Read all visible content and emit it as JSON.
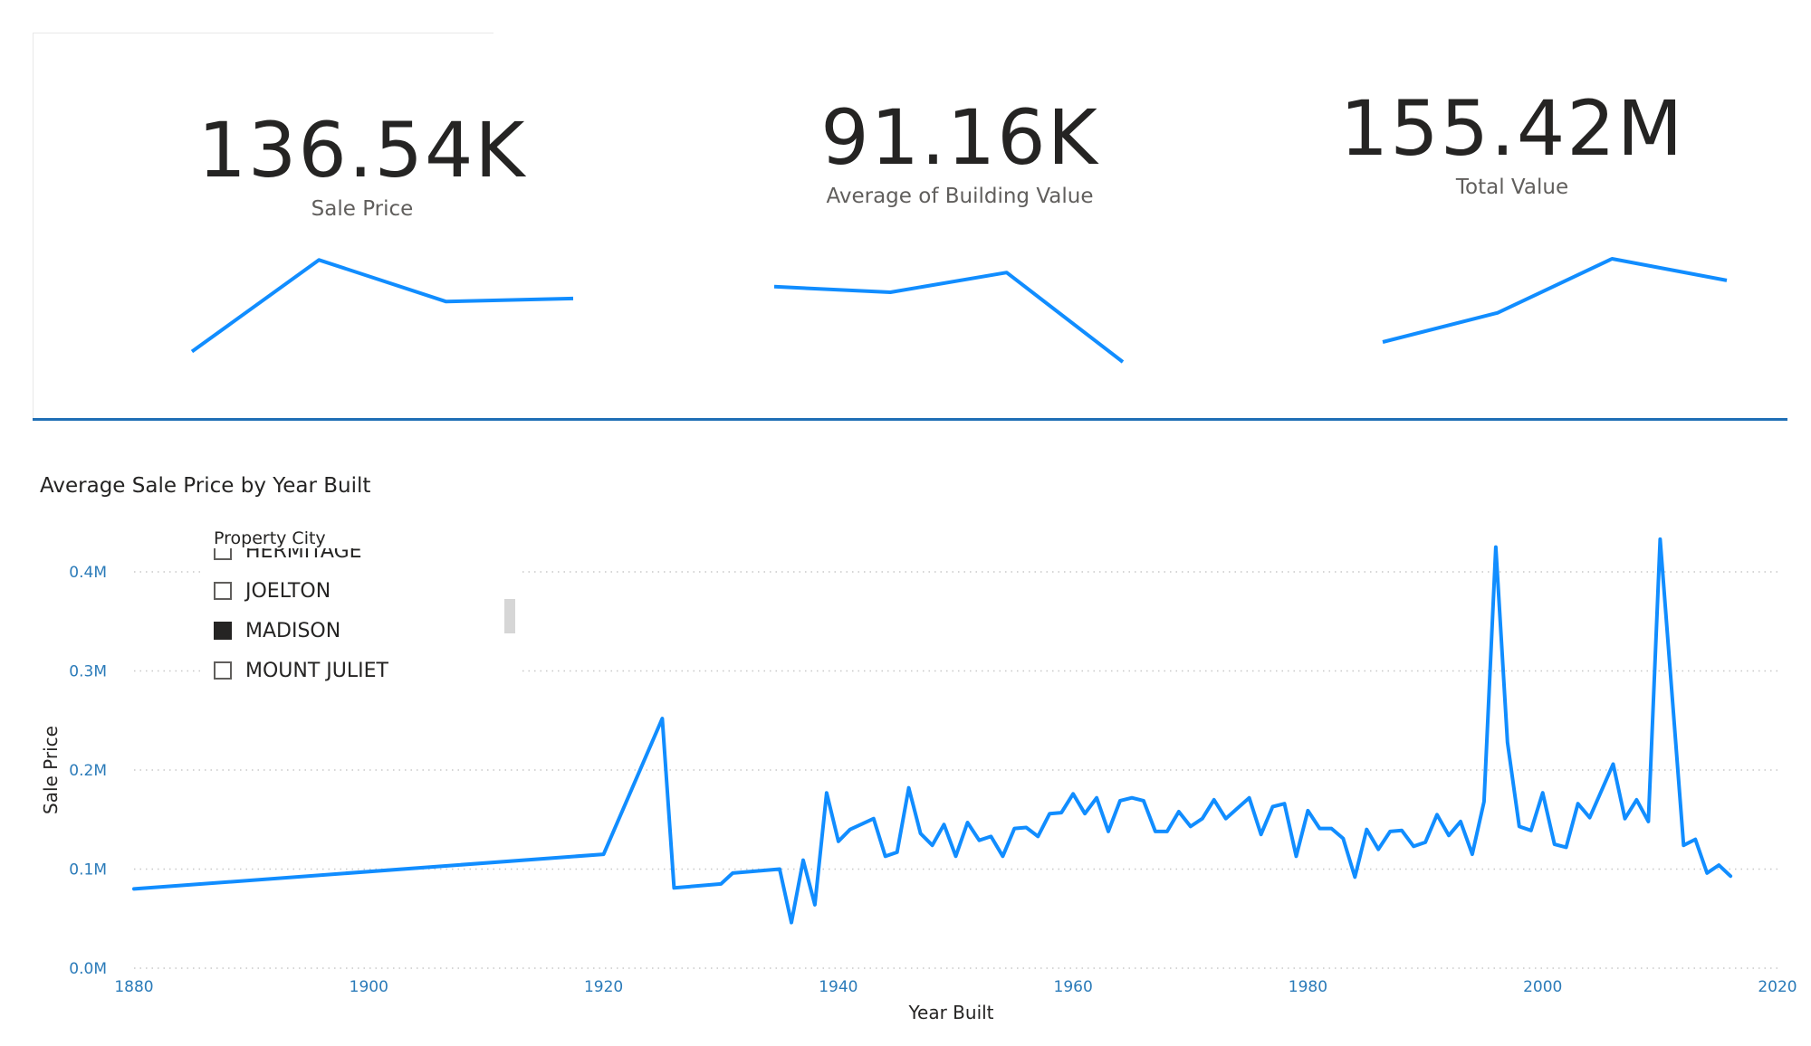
{
  "kpis": [
    {
      "value": "136.54K",
      "label": "Sale Price",
      "trend": [
        0.1,
        0.98,
        0.58,
        0.61
      ]
    },
    {
      "value": "91.16K",
      "label": "Average of Building Value",
      "trend": [
        0.8,
        0.74,
        0.95,
        0.0
      ]
    },
    {
      "value": "155.42M",
      "label": "Total Value",
      "trend": [
        0.0,
        0.35,
        1.0,
        0.74
      ]
    }
  ],
  "accent_color": "#118dff",
  "divider_color": "#1f6fb5",
  "slicer": {
    "header": "Property City",
    "items": [
      {
        "label": "HERMITAGE",
        "checked": false
      },
      {
        "label": "JOELTON",
        "checked": false
      },
      {
        "label": "MADISON",
        "checked": true
      },
      {
        "label": "MOUNT JULIET",
        "checked": false
      }
    ]
  },
  "chart_data": {
    "type": "line",
    "title": "Average Sale Price by Year Built",
    "xlabel": "Year Built",
    "ylabel": "Sale Price",
    "xlim": [
      1880,
      2020
    ],
    "ylim": [
      0,
      400000
    ],
    "x_ticks": [
      1880,
      1900,
      1920,
      1940,
      1960,
      1980,
      2000,
      2020
    ],
    "y_ticks": [
      {
        "value": 0,
        "label": "0.0M"
      },
      {
        "value": 100000,
        "label": "0.1M"
      },
      {
        "value": 200000,
        "label": "0.2M"
      },
      {
        "value": 300000,
        "label": "0.3M"
      },
      {
        "value": 400000,
        "label": "0.4M"
      }
    ],
    "grid": "horizontal-dotted",
    "series": [
      {
        "color": "#118dff",
        "points": [
          [
            1880,
            80000
          ],
          [
            1920,
            115000
          ],
          [
            1925,
            252000
          ],
          [
            1926,
            81000
          ],
          [
            1930,
            85000
          ],
          [
            1931,
            96000
          ],
          [
            1935,
            100000
          ],
          [
            1936,
            46000
          ],
          [
            1937,
            109000
          ],
          [
            1938,
            64000
          ],
          [
            1939,
            177000
          ],
          [
            1940,
            128000
          ],
          [
            1941,
            140000
          ],
          [
            1943,
            151000
          ],
          [
            1944,
            113000
          ],
          [
            1945,
            117000
          ],
          [
            1946,
            182000
          ],
          [
            1947,
            136000
          ],
          [
            1948,
            124000
          ],
          [
            1949,
            145000
          ],
          [
            1950,
            113000
          ],
          [
            1951,
            147000
          ],
          [
            1952,
            129000
          ],
          [
            1953,
            133000
          ],
          [
            1954,
            113000
          ],
          [
            1955,
            141000
          ],
          [
            1956,
            142000
          ],
          [
            1957,
            133000
          ],
          [
            1958,
            156000
          ],
          [
            1959,
            157000
          ],
          [
            1960,
            176000
          ],
          [
            1961,
            156000
          ],
          [
            1962,
            172000
          ],
          [
            1963,
            138000
          ],
          [
            1964,
            169000
          ],
          [
            1965,
            172000
          ],
          [
            1966,
            169000
          ],
          [
            1967,
            138000
          ],
          [
            1968,
            138000
          ],
          [
            1969,
            158000
          ],
          [
            1970,
            143000
          ],
          [
            1971,
            151000
          ],
          [
            1972,
            170000
          ],
          [
            1973,
            151000
          ],
          [
            1975,
            172000
          ],
          [
            1976,
            135000
          ],
          [
            1977,
            163000
          ],
          [
            1978,
            166000
          ],
          [
            1979,
            113000
          ],
          [
            1980,
            159000
          ],
          [
            1981,
            141000
          ],
          [
            1982,
            141000
          ],
          [
            1983,
            131000
          ],
          [
            1984,
            92000
          ],
          [
            1985,
            140000
          ],
          [
            1986,
            120000
          ],
          [
            1987,
            138000
          ],
          [
            1988,
            139000
          ],
          [
            1989,
            123000
          ],
          [
            1990,
            127000
          ],
          [
            1991,
            155000
          ],
          [
            1992,
            134000
          ],
          [
            1993,
            148000
          ],
          [
            1994,
            115000
          ],
          [
            1995,
            168000
          ],
          [
            1996,
            425000
          ],
          [
            1997,
            228000
          ],
          [
            1998,
            143000
          ],
          [
            1999,
            139000
          ],
          [
            2000,
            177000
          ],
          [
            2001,
            125000
          ],
          [
            2002,
            122000
          ],
          [
            2003,
            166000
          ],
          [
            2004,
            152000
          ],
          [
            2006,
            206000
          ],
          [
            2007,
            151000
          ],
          [
            2008,
            170000
          ],
          [
            2009,
            148000
          ],
          [
            2010,
            433000
          ],
          [
            2012,
            124000
          ],
          [
            2013,
            130000
          ],
          [
            2014,
            96000
          ],
          [
            2015,
            104000
          ],
          [
            2016,
            93000
          ]
        ]
      }
    ]
  }
}
